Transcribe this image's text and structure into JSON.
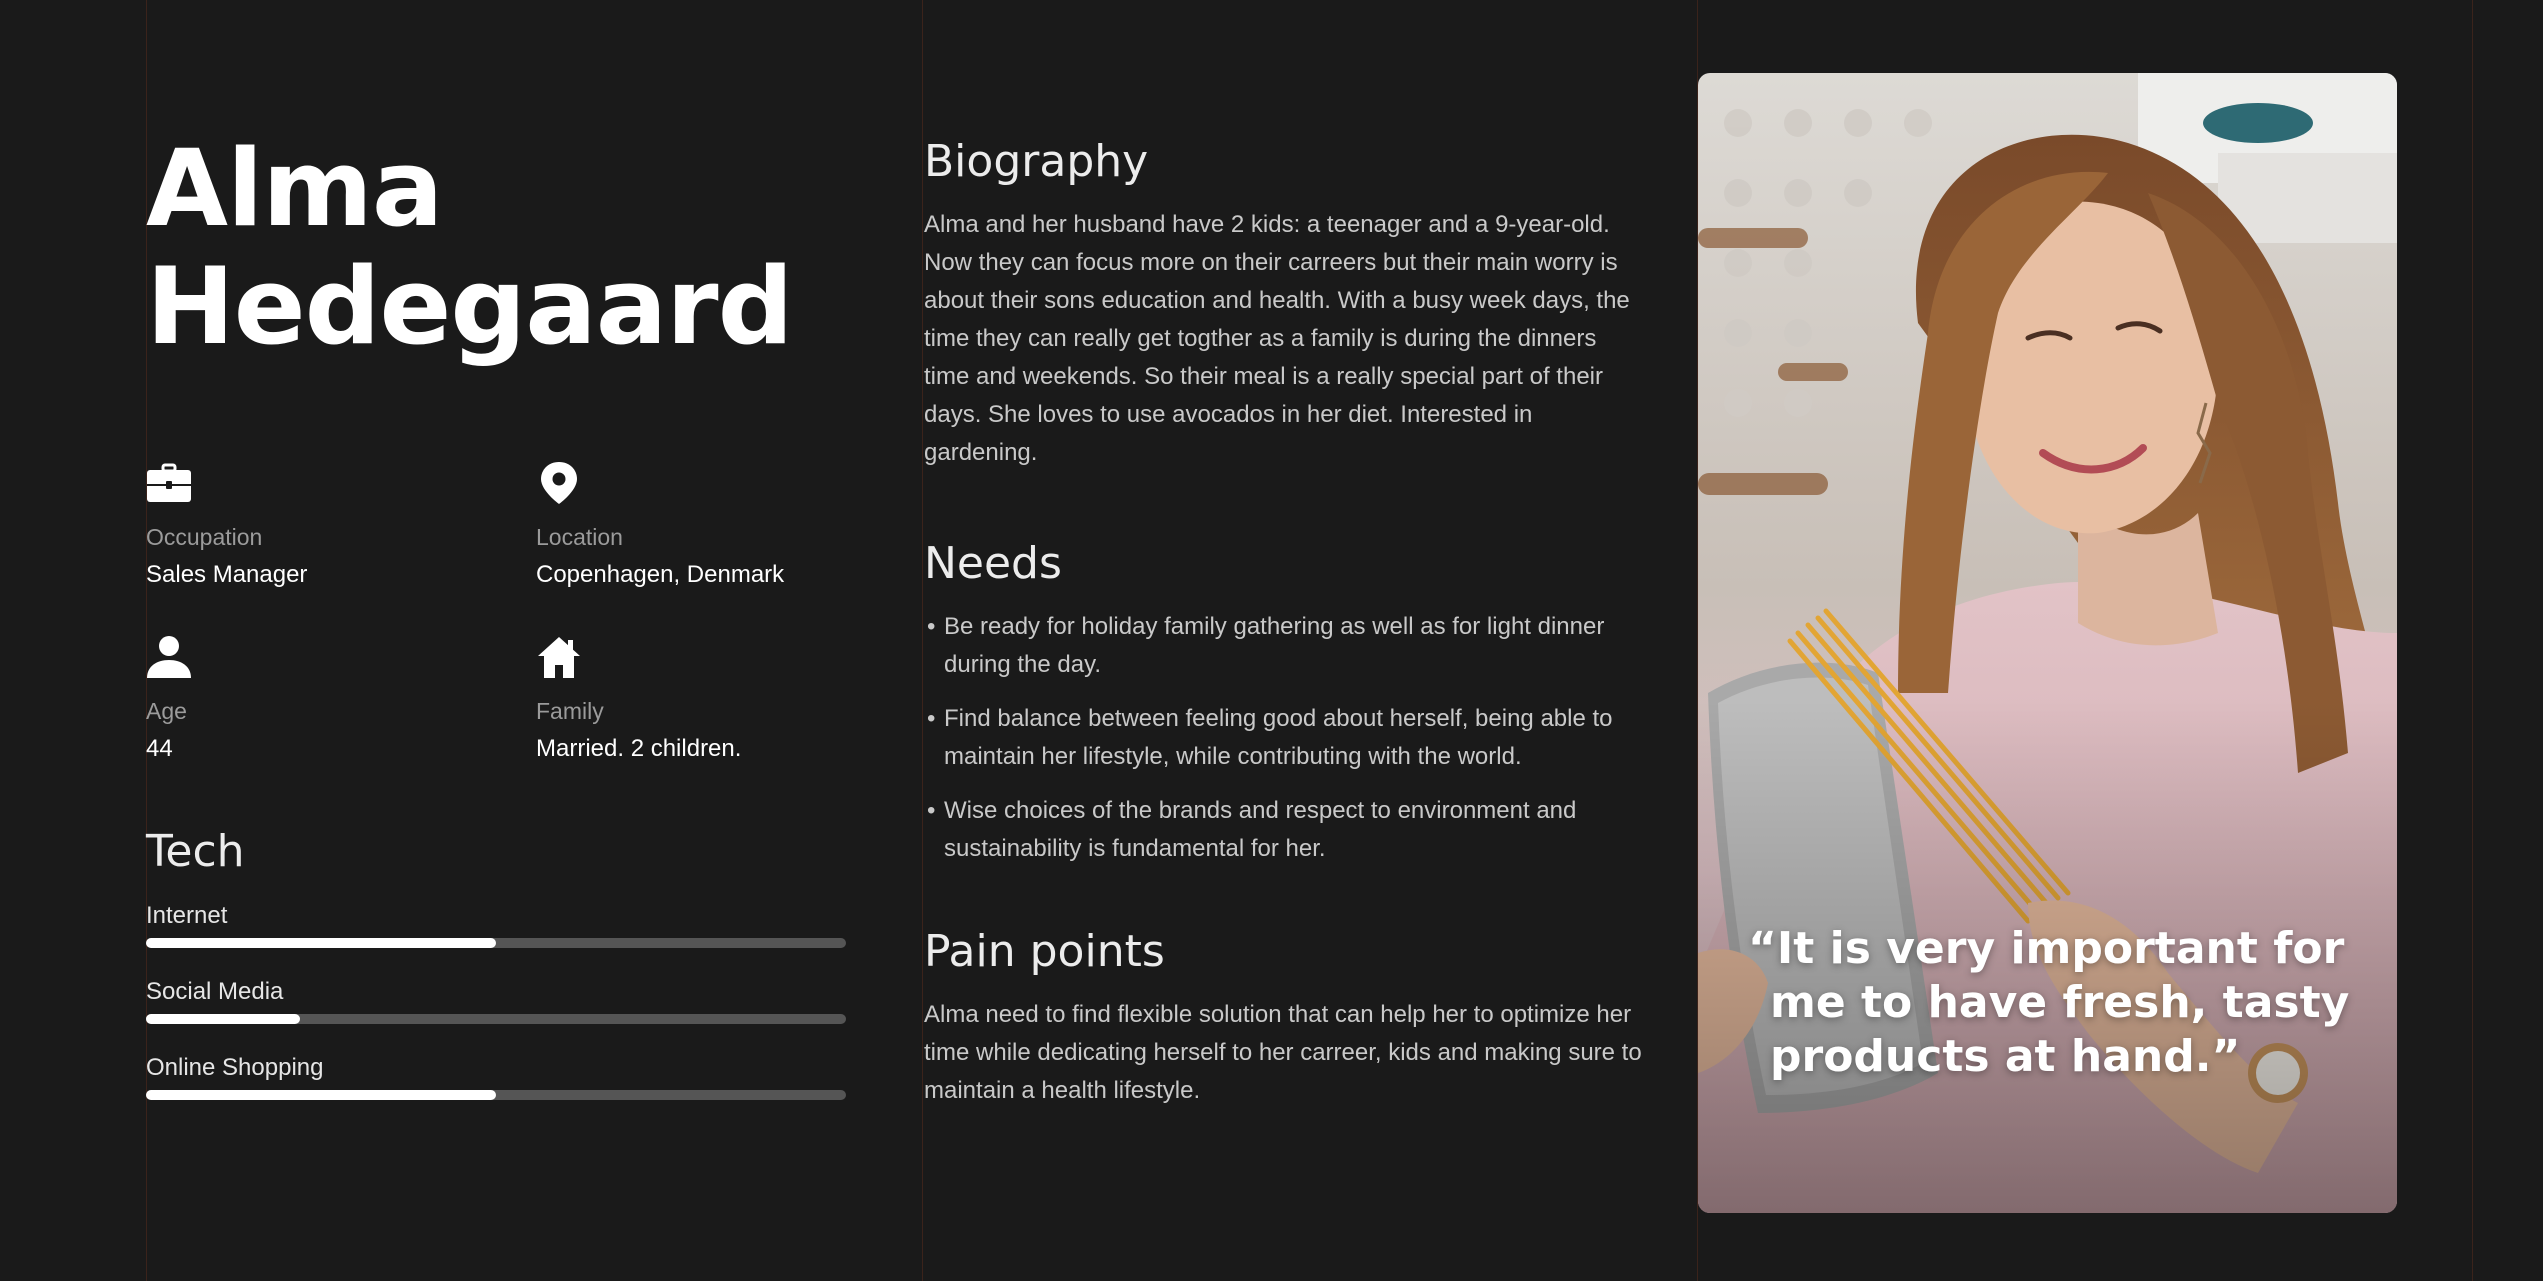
{
  "persona": {
    "first_name": "Alma",
    "last_name": "Hedegaard"
  },
  "info": {
    "occupation": {
      "label": "Occupation",
      "value": "Sales Manager",
      "icon": "briefcase-icon"
    },
    "location": {
      "label": "Location",
      "value": "Copenhagen, Denmark",
      "icon": "map-pin-icon"
    },
    "age": {
      "label": "Age",
      "value": "44",
      "icon": "user-icon"
    },
    "family": {
      "label": "Family",
      "value": "Married. 2 children.",
      "icon": "home-icon"
    }
  },
  "tech": {
    "title": "Tech",
    "items": [
      {
        "label": "Internet",
        "level": 0.5
      },
      {
        "label": "Social Media",
        "level": 0.22
      },
      {
        "label": "Online Shopping",
        "level": 0.5
      }
    ]
  },
  "biography": {
    "title": "Biography",
    "text": "Alma and her husband have 2 kids: a teenager and a 9-year-old. Now they can focus more on their carreers but their main worry is about their sons education and health. With a busy week days, the time they can really get togther as a family is during the dinners time and weekends. So their meal is a really special part of their days. She loves to use avocados in her diet. Interested in gardening."
  },
  "needs": {
    "title": "Needs",
    "items": [
      "Be ready for holiday family gathering as well as for light dinner during the day.",
      "Find balance between feeling good about herself, being able to maintain her lifestyle, while contributing with the world.",
      "Wise choices of the brands and respect to environment and sustainability is fundamental for her."
    ]
  },
  "pain_points": {
    "title": "Pain points",
    "text": "Alma need to find flexible solution that can help her to optimize her time while dedicating herself to her carreer, kids and making sure to maintain a health lifestyle."
  },
  "quote": "“It is very important for me to have fresh, tasty products at hand.”",
  "colors": {
    "background": "#1a1a1a",
    "guide_line": "#3b231b",
    "bar_track": "#555555",
    "bar_fill": "#ffffff"
  }
}
